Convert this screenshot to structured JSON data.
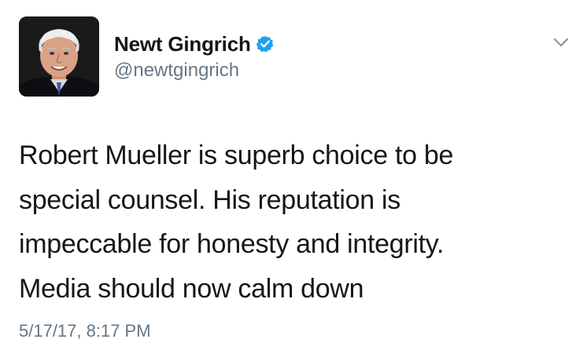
{
  "author": {
    "display_name": "Newt Gingrich",
    "handle": "@newtgingrich",
    "verified": true,
    "avatar_icon": "profile-photo",
    "verified_color": "#1da1f2"
  },
  "menu": {
    "icon": "chevron-down-icon"
  },
  "tweet": {
    "lines": [
      "Robert Mueller is superb choice to be",
      "special counsel. His reputation is",
      "impeccable for honesty and integrity.",
      "Media should now calm down"
    ],
    "timestamp": "5/17/17, 8:17 PM"
  },
  "colors": {
    "text": "#14171a",
    "secondary": "#657786",
    "background": "#ffffff"
  }
}
